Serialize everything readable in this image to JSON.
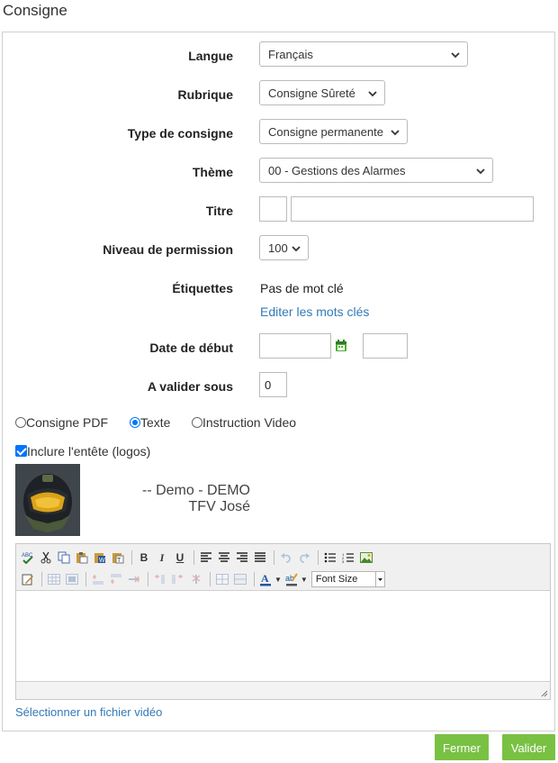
{
  "page": {
    "title": "Consigne"
  },
  "form": {
    "langue": {
      "label": "Langue",
      "value": "Français"
    },
    "rubrique": {
      "label": "Rubrique",
      "value": "Consigne Sûreté"
    },
    "type": {
      "label": "Type de consigne",
      "value": "Consigne permanente"
    },
    "theme": {
      "label": "Thème",
      "value": "00 - Gestions des Alarmes"
    },
    "titre": {
      "label": "Titre",
      "prefix_value": "",
      "value": ""
    },
    "permission": {
      "label": "Niveau de permission",
      "value": "100"
    },
    "etiquettes": {
      "label": "Étiquettes",
      "value": "Pas de mot clé",
      "edit_link": "Editer les mots clés"
    },
    "date_debut": {
      "label": "Date de début",
      "date_value": "",
      "time_value": ""
    },
    "valider_sous": {
      "label": "A valider sous",
      "value": "0"
    }
  },
  "content_type": {
    "options": [
      "Consigne PDF",
      "Texte",
      "Instruction Video"
    ],
    "selected": "Texte"
  },
  "header_option": {
    "label": "Inclure l'entête (logos)",
    "checked": true
  },
  "header_preview": {
    "line1": "-- Demo - DEMO",
    "line2": "TFV José"
  },
  "editor": {
    "font_size_label": "Font Size",
    "toolbar_row1": [
      "spellcheck-icon",
      "cut-icon",
      "copy-icon",
      "paste-icon",
      "paste-word-icon",
      "paste-text-icon",
      "bold-icon",
      "italic-icon",
      "underline-icon",
      "align-left-icon",
      "align-center-icon",
      "align-right-icon",
      "align-justify-icon",
      "undo-icon",
      "redo-icon",
      "bullet-list-icon",
      "numbered-list-icon",
      "image-icon"
    ],
    "toolbar_row2": [
      "edit-source-icon",
      "table-icon",
      "table-props-icon",
      "row-before-icon",
      "row-after-icon",
      "delete-row-icon",
      "col-before-icon",
      "col-after-icon",
      "delete-col-icon",
      "split-cells-icon",
      "merge-cells-icon",
      "font-color-icon",
      "highlight-color-icon"
    ],
    "content": ""
  },
  "video_link": "Sélectionner un fichier vidéo",
  "buttons": {
    "close": "Fermer",
    "submit": "Valider"
  },
  "colors": {
    "accent_green": "#79c143",
    "link_blue": "#337ab7",
    "calendar_green": "#4caf32"
  }
}
